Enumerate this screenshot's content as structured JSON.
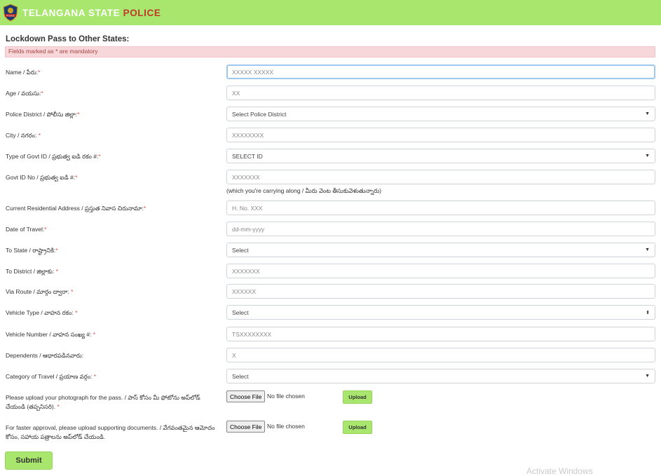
{
  "header": {
    "brand_main": "TELANGANA STATE ",
    "brand_accent": "POLICE",
    "logo_text": "POLICE",
    "colors": {
      "bar": "#a8e66d",
      "accent": "#c0392b"
    },
    "logo_icon": "police-badge-icon"
  },
  "form": {
    "title": "Lockdown Pass to Other States:",
    "mandatory_note": "Fields marked as * are mandatory",
    "fields": [
      {
        "label": "Name / పేరు:",
        "req": "*",
        "value": "XXXXX XXXXX"
      },
      {
        "label": "Age / వయసు:",
        "req": "*",
        "value": "XX"
      },
      {
        "label": "Police District / పోలీసు జిల్లా:",
        "req": "*",
        "value": "Select Police District"
      },
      {
        "label": "City / నగరం: ",
        "req": "*",
        "value": "XXXXXXXX"
      },
      {
        "label": "Type of Govt ID / ప్రభుత్వ ఐడి రకం #:",
        "req": "*",
        "value": "SELECT ID"
      },
      {
        "label": "Govt ID No / ప్రభుత్వ ఐడి #:",
        "req": "*",
        "value": "XXXXXXX",
        "help": "(which you're carrying along / మీరు వెంట తీసుకువెళుతున్నారు)"
      },
      {
        "label": "Current Residential Address / ప్రస్తుత నివాస చిరునామా:",
        "req": "*",
        "value": "H. No. XXX"
      },
      {
        "label": "Date of Travel:",
        "req": "*",
        "value": "dd-mm-yyyy"
      },
      {
        "label": "To State / రాష్ట్రానికి:",
        "req": "*",
        "value": "Select"
      },
      {
        "label": "To District / జిల్లాకు: ",
        "req": "*",
        "value": "XXXXXXX"
      },
      {
        "label": "Via Route / మార్గం ద్వారా: ",
        "req": "*",
        "value": "XXXXXX"
      },
      {
        "label": "Vehicle Type / వాహన రకం: ",
        "req": "*",
        "value": "Select"
      },
      {
        "label": "Vehicle Number / వాహన సంఖ్య #: ",
        "req": "*",
        "value": "TSXXXXXXXX"
      },
      {
        "label": "Dependents / ఆధారపడినవారు:",
        "req": "",
        "value": "X"
      },
      {
        "label": "Category of Travel / ప్రయాణ వర్గం: ",
        "req": "*",
        "value": "Select"
      }
    ],
    "uploads": [
      {
        "label": "Please upload your photograph for the pass. / పాస్ కోసం మీ ఫోటోను అప్‌లోడ్ చేయండి (తప్పనిసరి). ",
        "req": "*",
        "choose": "Choose File",
        "status": "No file chosen",
        "upload": "Upload"
      },
      {
        "label": "For faster approval, please upload supporting documents. / వేగవంతమైన ఆమోదం కోసం, సహాయ పత్రాలను అప్‌లోడ్ చేయండి.",
        "req": "",
        "choose": "Choose File",
        "status": "No file chosen",
        "upload": "Upload"
      }
    ],
    "submit": "Submit"
  },
  "watermark": "Activate Windows"
}
